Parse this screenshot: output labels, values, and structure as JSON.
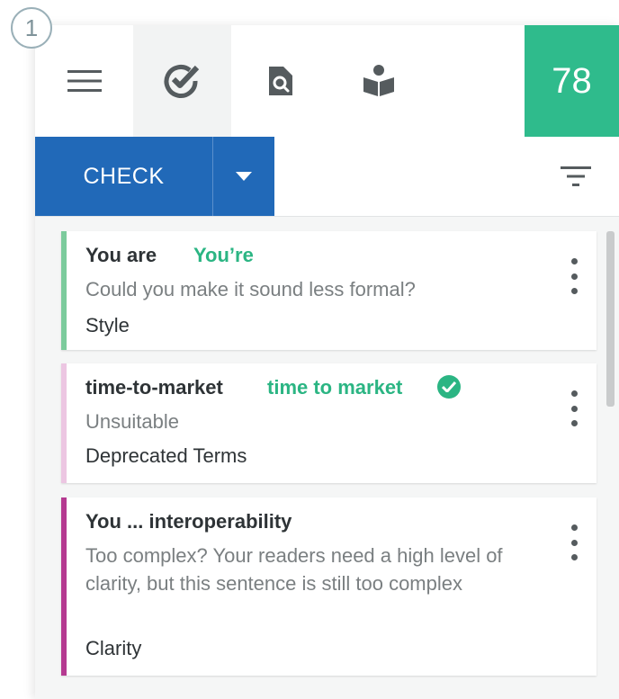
{
  "step_number": "1",
  "toolbar": {
    "tools": [
      {
        "name": "menu-icon"
      },
      {
        "name": "checklist-icon"
      },
      {
        "name": "document-search-icon"
      },
      {
        "name": "reader-book-icon"
      }
    ],
    "score": "78",
    "score_color": "#2fbb8c"
  },
  "actions": {
    "check_label": "CHECK",
    "check_color": "#2169b8"
  },
  "cards": [
    {
      "original": "You are",
      "suggestion": "You’re",
      "description": "Could you make it sound less formal?",
      "category": "Style",
      "accent_color": "#7ccb9c",
      "accepted": false
    },
    {
      "original": "time-to-market",
      "suggestion": "time to market",
      "description": "Unsuitable",
      "category": "Deprecated Terms",
      "accent_color": "#ecc6e2",
      "accepted": true
    },
    {
      "original": "You ... interoperability",
      "suggestion": "",
      "description": "Too complex? Your readers need a high level of clarity, but this sentence is still too complex",
      "category": "Clarity",
      "accent_color": "#b53a91",
      "accepted": false
    }
  ]
}
